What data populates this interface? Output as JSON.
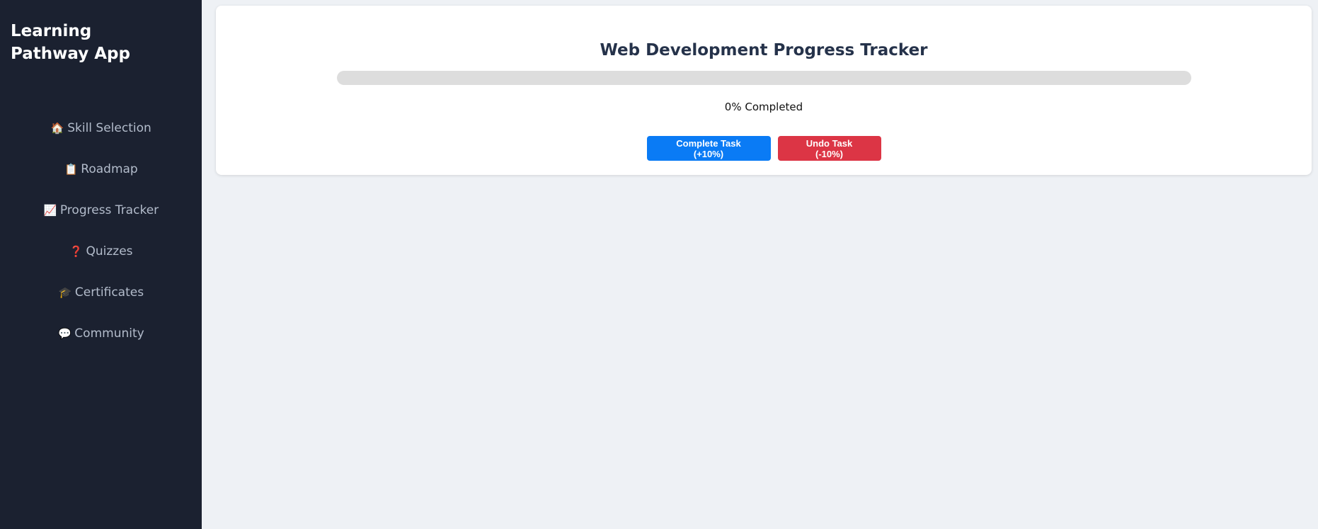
{
  "sidebar": {
    "brand": "Learning Pathway App",
    "items": [
      {
        "icon": "🏠",
        "icon_name": "home-icon",
        "label": "Skill Selection"
      },
      {
        "icon": "📋",
        "icon_name": "clipboard-icon",
        "label": "Roadmap"
      },
      {
        "icon": "📈",
        "icon_name": "chart-increasing-icon",
        "label": "Progress Tracker"
      },
      {
        "icon": "❓",
        "icon_name": "question-mark-icon",
        "label": "Quizzes"
      },
      {
        "icon": "🎓",
        "icon_name": "graduation-cap-icon",
        "label": "Certificates"
      },
      {
        "icon": "💬",
        "icon_name": "speech-bubble-icon",
        "label": "Community"
      }
    ]
  },
  "main": {
    "title": "Web Development Progress Tracker",
    "progress": {
      "value": 0,
      "text": "0% Completed"
    },
    "buttons": {
      "complete_label": "Complete Task (+10%)",
      "undo_label": "Undo Task (-10%)"
    }
  },
  "colors": {
    "sidebar_bg": "#1b2130",
    "page_bg": "#eef1f5",
    "complete_button": "#0a7bf5",
    "undo_button": "#dc3545",
    "progress_track": "#dddddd"
  }
}
